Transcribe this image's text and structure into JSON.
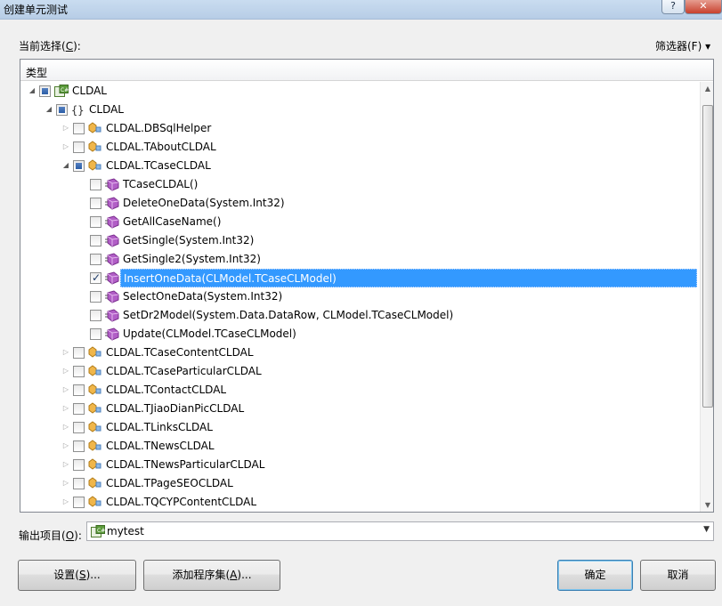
{
  "window": {
    "title": "创建单元测试",
    "help_label": "?",
    "close_label": "✕"
  },
  "current_selection": {
    "label": "当前选择",
    "accel": "C"
  },
  "filter": {
    "label": "筛选器(F)",
    "arrow": "▾"
  },
  "tree": {
    "header": "类型",
    "nodes": [
      {
        "label": "CLDAL",
        "check": "partial",
        "icon": "csharp-project-icon",
        "expander": "◢"
      },
      {
        "label": "CLDAL",
        "check": "partial",
        "icon": "namespace-icon",
        "icon_text": "{}",
        "expander": "◢"
      },
      {
        "label": "CLDAL.DBSqlHelper",
        "check": "none",
        "icon": "class-icon",
        "expander": "▷"
      },
      {
        "label": "CLDAL.TAboutCLDAL",
        "check": "none",
        "icon": "class-icon",
        "expander": "▷"
      },
      {
        "label": "CLDAL.TCaseCLDAL",
        "check": "partial",
        "icon": "class-icon",
        "expander": "◢"
      },
      {
        "label": "TCaseCLDAL()",
        "check": "none",
        "icon": "method-icon",
        "expander": ""
      },
      {
        "label": "DeleteOneData(System.Int32)",
        "check": "none",
        "icon": "method-icon",
        "expander": ""
      },
      {
        "label": "GetAllCaseName()",
        "check": "none",
        "icon": "method-icon",
        "expander": ""
      },
      {
        "label": "GetSingle(System.Int32)",
        "check": "none",
        "icon": "method-icon",
        "expander": ""
      },
      {
        "label": "GetSingle2(System.Int32)",
        "check": "none",
        "icon": "method-icon",
        "expander": ""
      },
      {
        "label": "InsertOneData(CLModel.TCaseCLModel)",
        "check": "checked",
        "icon": "method-icon",
        "expander": "",
        "selected": true
      },
      {
        "label": "SelectOneData(System.Int32)",
        "check": "none",
        "icon": "method-icon",
        "expander": ""
      },
      {
        "label": "SetDr2Model(System.Data.DataRow, CLModel.TCaseCLModel)",
        "check": "none",
        "icon": "method-icon",
        "expander": ""
      },
      {
        "label": "Update(CLModel.TCaseCLModel)",
        "check": "none",
        "icon": "method-icon",
        "expander": ""
      },
      {
        "label": "CLDAL.TCaseContentCLDAL",
        "check": "none",
        "icon": "class-icon",
        "expander": "▷"
      },
      {
        "label": "CLDAL.TCaseParticularCLDAL",
        "check": "none",
        "icon": "class-icon",
        "expander": "▷"
      },
      {
        "label": "CLDAL.TContactCLDAL",
        "check": "none",
        "icon": "class-icon",
        "expander": "▷"
      },
      {
        "label": "CLDAL.TJiaoDianPicCLDAL",
        "check": "none",
        "icon": "class-icon",
        "expander": "▷"
      },
      {
        "label": "CLDAL.TLinksCLDAL",
        "check": "none",
        "icon": "class-icon",
        "expander": "▷"
      },
      {
        "label": "CLDAL.TNewsCLDAL",
        "check": "none",
        "icon": "class-icon",
        "expander": "▷"
      },
      {
        "label": "CLDAL.TNewsParticularCLDAL",
        "check": "none",
        "icon": "class-icon",
        "expander": "▷"
      },
      {
        "label": "CLDAL.TPageSEOCLDAL",
        "check": "none",
        "icon": "class-icon",
        "expander": "▷"
      },
      {
        "label": "CLDAL.TQCYPContentCLDAL",
        "check": "none",
        "icon": "class-icon",
        "expander": "▷"
      }
    ]
  },
  "output_project": {
    "label": "输出项目",
    "accel": "O",
    "value": "mytest",
    "icon": "csharp-project-icon"
  },
  "buttons": {
    "settings": {
      "label": "设置",
      "accel": "S",
      "suffix": "..."
    },
    "add_assembly": {
      "label": "添加程序集",
      "accel": "A",
      "suffix": "..."
    },
    "ok": "确定",
    "cancel": "取消"
  },
  "colors": {
    "selection": "#3399ff",
    "titlebar": "#c9dcf0",
    "close": "#c8412d"
  }
}
